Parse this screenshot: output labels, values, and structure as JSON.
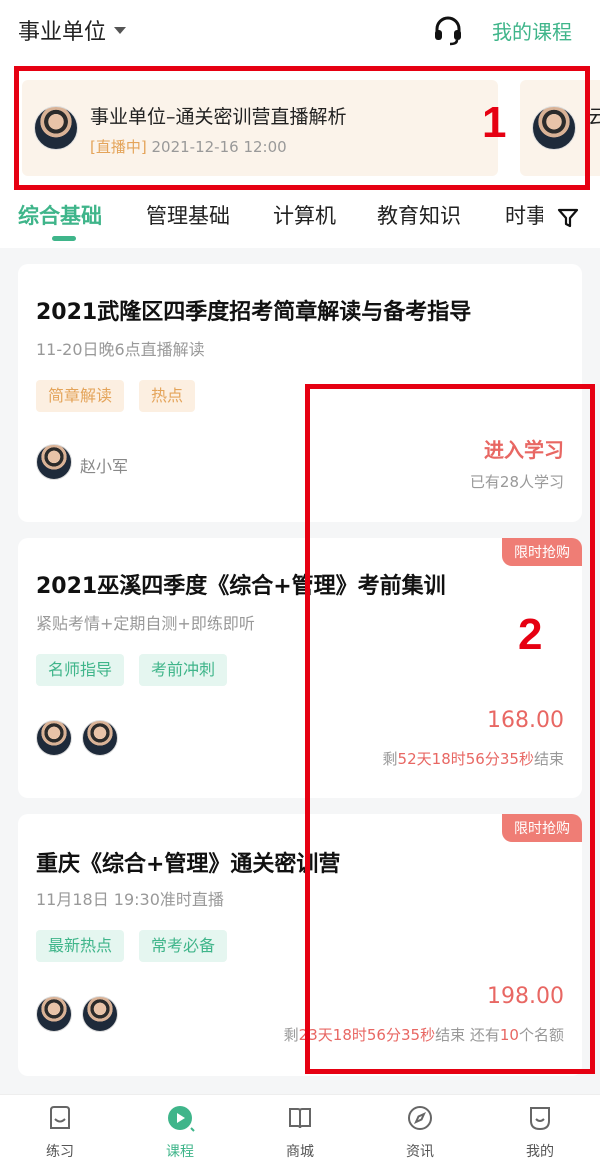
{
  "header": {
    "location": "事业单位",
    "my_courses": "我的课程"
  },
  "banner": [
    {
      "title": "事业单位–通关密训营直播解析",
      "status": "[直播中]",
      "datetime": "2021-12-16 12:00"
    },
    {
      "title": "云"
    }
  ],
  "annotations": [
    "1",
    "2"
  ],
  "tabs": [
    "综合基础",
    "管理基础",
    "计算机",
    "教育知识",
    "时事"
  ],
  "active_tab": "综合基础",
  "courses": [
    {
      "title": "2021武隆区四季度招考简章解读与备考指导",
      "subtitle": "11-20日晚6点直播解读",
      "tags": [
        "简章解读",
        "热点"
      ],
      "teacher": "赵小军",
      "action": "进入学习",
      "learners": "已有28人学习"
    },
    {
      "ribbon": "限时抢购",
      "title": "2021巫溪四季度《综合+管理》考前集训",
      "subtitle": "紧贴考情+定期自测+即练即听",
      "tags": [
        "名师指导",
        "考前冲刺"
      ],
      "price": "168.00",
      "countdown": {
        "prefix": "剩",
        "days": "52",
        "d": "天",
        "hours": "18",
        "h": "时",
        "minutes": "56",
        "m": "分",
        "seconds": "35",
        "s": "秒",
        "suffix": "结束"
      }
    },
    {
      "ribbon": "限时抢购",
      "title": "重庆《综合+管理》通关密训营",
      "subtitle": "11月18日 19:30准时直播",
      "tags": [
        "最新热点",
        "常考必备"
      ],
      "price": "198.00",
      "countdown": {
        "prefix": "剩",
        "days": "23",
        "d": "天",
        "hours": "18",
        "h": "时",
        "minutes": "56",
        "m": "分",
        "seconds": "35",
        "s": "秒",
        "suffix": "结束 还有",
        "quota": "10",
        "quota_suffix": "个名额"
      }
    }
  ],
  "bottom_nav": [
    "练习",
    "课程",
    "商城",
    "资讯",
    "我的"
  ],
  "colors": {
    "accent": "#3fb58a",
    "price": "#e86763",
    "highlight_box": "#e60012",
    "tag_orange": "#e4a45a"
  }
}
